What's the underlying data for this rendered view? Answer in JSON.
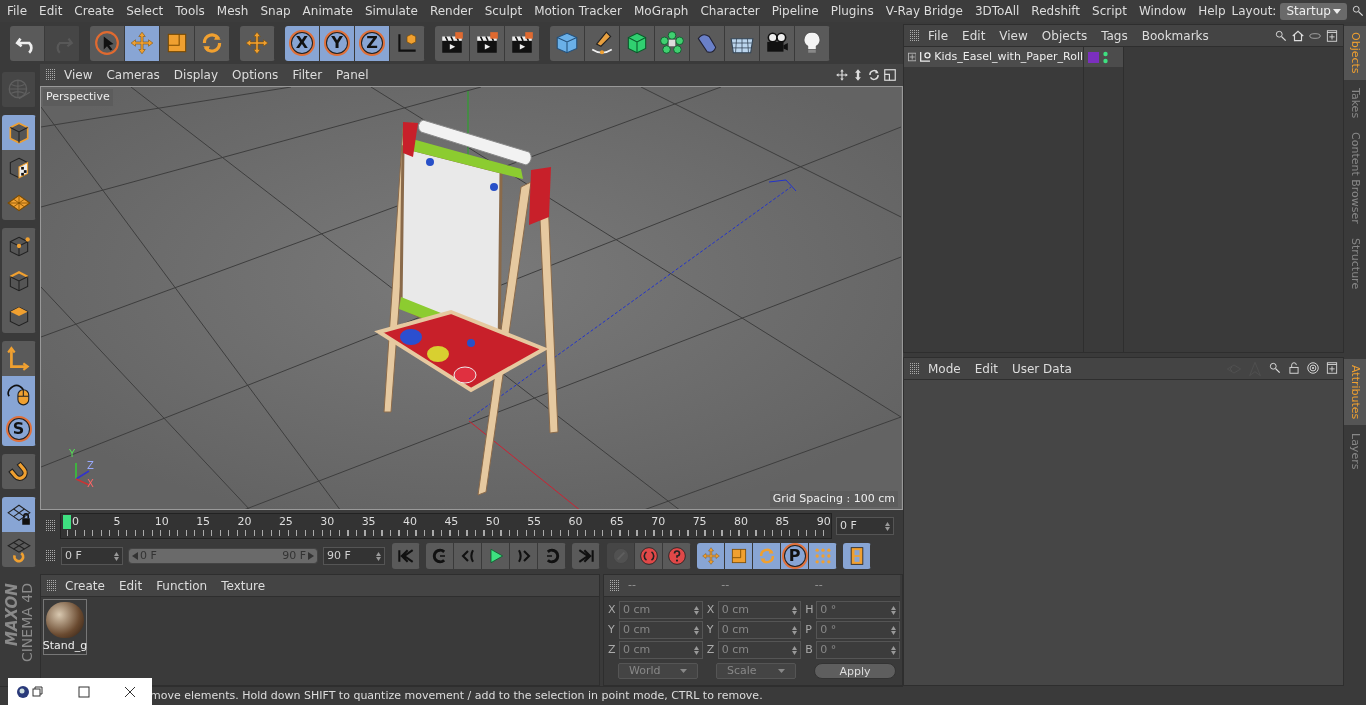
{
  "menu_bar": [
    "File",
    "Edit",
    "Create",
    "Select",
    "Tools",
    "Mesh",
    "Snap",
    "Animate",
    "Simulate",
    "Render",
    "Sculpt",
    "Motion Tracker",
    "MoGraph",
    "Character",
    "Pipeline",
    "Plugins",
    "V-Ray Bridge",
    "3DToAll",
    "Redshift",
    "Script",
    "Window",
    "Help"
  ],
  "layout": {
    "label": "Layout:",
    "value": "Startup"
  },
  "toolbar": [
    [
      {
        "kind": "undo",
        "selected": false,
        "disabled": false
      },
      {
        "kind": "redo",
        "selected": false,
        "disabled": true
      }
    ],
    [
      {
        "kind": "select",
        "selected": false,
        "disabled": false
      },
      {
        "kind": "move",
        "selected": true,
        "disabled": false
      },
      {
        "kind": "scale",
        "selected": false,
        "disabled": false
      },
      {
        "kind": "rotate",
        "selected": false,
        "disabled": false
      }
    ],
    [
      {
        "kind": "move",
        "selected": false,
        "disabled": false
      }
    ],
    [
      {
        "kind": "letter",
        "label": "X",
        "selected": true,
        "disabled": false
      },
      {
        "kind": "letter",
        "label": "Y",
        "selected": true,
        "disabled": false
      },
      {
        "kind": "letter",
        "label": "Z",
        "selected": true,
        "disabled": false
      },
      {
        "kind": "coords",
        "selected": false,
        "disabled": false
      }
    ],
    [
      {
        "kind": "clapper",
        "selected": false,
        "disabled": false
      },
      {
        "kind": "clapper",
        "selected": false,
        "disabled": false
      },
      {
        "kind": "clapper",
        "selected": false,
        "disabled": false
      }
    ],
    [
      {
        "kind": "cube",
        "selected": false,
        "disabled": false
      },
      {
        "kind": "pen",
        "selected": false,
        "disabled": false
      },
      {
        "kind": "green-cube",
        "selected": false,
        "disabled": false
      },
      {
        "kind": "cloner",
        "selected": false,
        "disabled": false
      },
      {
        "kind": "bend",
        "selected": false,
        "disabled": false
      },
      {
        "kind": "floor",
        "selected": false,
        "disabled": false
      },
      {
        "kind": "camera",
        "selected": false,
        "disabled": false
      },
      {
        "kind": "bulb",
        "selected": false,
        "disabled": false
      }
    ]
  ],
  "left_toolbar": [
    [
      {
        "kind": "globe",
        "selected": false,
        "disabled": true
      }
    ],
    [
      {
        "kind": "model",
        "selected": true,
        "disabled": false
      },
      {
        "kind": "checker-cube",
        "selected": false,
        "disabled": false
      },
      {
        "kind": "mesh-grid",
        "selected": false,
        "disabled": false
      }
    ],
    [
      {
        "kind": "points",
        "selected": false,
        "disabled": false
      },
      {
        "kind": "edges",
        "selected": false,
        "disabled": false
      },
      {
        "kind": "faces",
        "selected": false,
        "disabled": false
      }
    ],
    [
      {
        "kind": "axis",
        "selected": false,
        "disabled": false
      },
      {
        "kind": "mouse",
        "selected": true,
        "disabled": false
      },
      {
        "kind": "letter",
        "label": "S",
        "selected": true,
        "disabled": false
      }
    ],
    [
      {
        "kind": "magnet",
        "selected": false,
        "disabled": false
      }
    ],
    [
      {
        "kind": "grid-lock",
        "selected": true,
        "disabled": false
      },
      {
        "kind": "grid-rotate",
        "selected": false,
        "disabled": false
      }
    ]
  ],
  "branding": {
    "company": "MAXON",
    "product": "CINEMA 4D"
  },
  "viewport": {
    "menu": [
      "View",
      "Cameras",
      "Display",
      "Options",
      "Filter",
      "Panel"
    ],
    "camera": "Perspective",
    "grid_spacing": "Grid Spacing : 100 cm",
    "axis_labels": [
      "Y",
      "Z",
      "X"
    ]
  },
  "timeline": {
    "ticks": [
      "0",
      "5",
      "10",
      "15",
      "20",
      "25",
      "30",
      "35",
      "40",
      "45",
      "50",
      "55",
      "60",
      "65",
      "70",
      "75",
      "80",
      "85",
      "90"
    ],
    "current_frame": "0 F",
    "start": "0 F",
    "range": {
      "start": "0 F",
      "end": "90 F",
      "level": 1
    },
    "end": "90 F",
    "playback": [
      [
        {
          "kind": "first"
        }
      ],
      [
        {
          "kind": "prev-key"
        },
        {
          "kind": "prev-frame"
        },
        {
          "kind": "play"
        },
        {
          "kind": "next-frame"
        },
        {
          "kind": "next-key"
        }
      ],
      [
        {
          "kind": "last"
        }
      ]
    ],
    "keys": [
      [
        {
          "kind": "record",
          "selected": false,
          "disabled": true
        },
        {
          "kind": "autokey",
          "selected": false,
          "disabled": false
        },
        {
          "kind": "keyhelp",
          "selected": false,
          "disabled": false
        }
      ],
      [
        {
          "kind": "move",
          "selected": true,
          "disabled": false
        },
        {
          "kind": "scale",
          "selected": true,
          "disabled": false
        },
        {
          "kind": "rotate",
          "selected": true,
          "disabled": false
        },
        {
          "kind": "letter",
          "label": "P",
          "selected": true,
          "disabled": false
        },
        {
          "kind": "dots",
          "selected": true,
          "disabled": false
        }
      ],
      [
        {
          "kind": "film",
          "selected": true,
          "disabled": false
        }
      ]
    ]
  },
  "materials": {
    "menu": [
      "Create",
      "Edit",
      "Function",
      "Texture"
    ],
    "items": [
      {
        "name": "Stand_g"
      }
    ]
  },
  "coordinates": {
    "headers": [
      "--",
      "--",
      "--"
    ],
    "columns": [
      [
        {
          "axis": "X",
          "value": "0 cm"
        },
        {
          "axis": "Y",
          "value": "0 cm"
        },
        {
          "axis": "Z",
          "value": "0 cm"
        }
      ],
      [
        {
          "axis": "X",
          "value": "0 cm"
        },
        {
          "axis": "Y",
          "value": "0 cm"
        },
        {
          "axis": "Z",
          "value": "0 cm"
        }
      ],
      [
        {
          "axis": "H",
          "value": "0 °"
        },
        {
          "axis": "P",
          "value": "0 °"
        },
        {
          "axis": "B",
          "value": "0 °"
        }
      ]
    ],
    "dropdowns": [
      "World",
      "Scale"
    ],
    "apply": "Apply"
  },
  "status_bar": "move elements. Hold down SHIFT to quantize movement / add to the selection in point mode, CTRL to remove.",
  "objects_panel": {
    "menu": [
      "File",
      "Edit",
      "View",
      "Objects",
      "Tags",
      "Bookmarks"
    ],
    "objects": [
      {
        "name": "Kids_Easel_with_Paper_Roll",
        "color": "#7b2fbe"
      }
    ],
    "tabs": [
      {
        "label": "Objects",
        "selected": true
      },
      {
        "label": "Takes",
        "selected": false
      },
      {
        "label": "Content Browser",
        "selected": false
      },
      {
        "label": "Structure",
        "selected": false
      }
    ]
  },
  "attributes_panel": {
    "menu": [
      "Mode",
      "Edit",
      "User Data"
    ],
    "tabs": [
      {
        "label": "Attributes",
        "selected": true
      },
      {
        "label": "Layers",
        "selected": false
      }
    ]
  }
}
